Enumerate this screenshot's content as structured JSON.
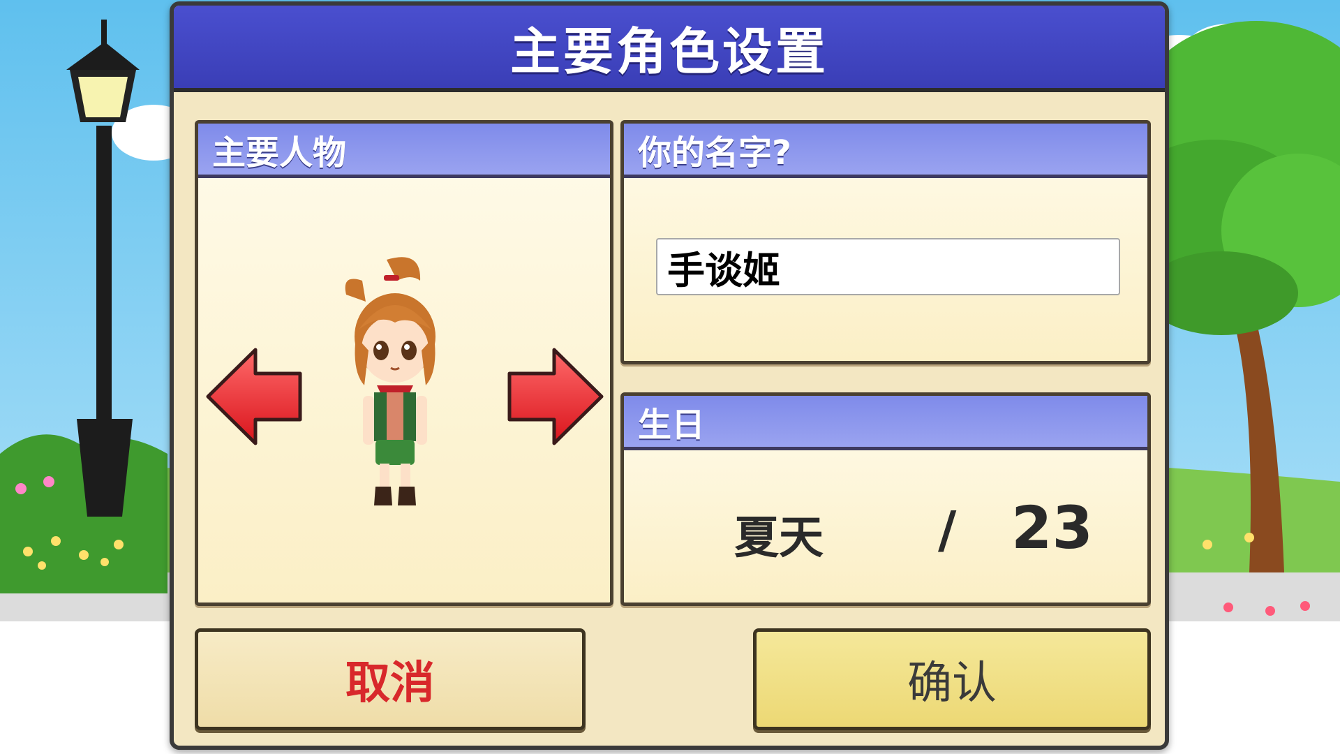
{
  "dialog": {
    "title": "主要角色设置"
  },
  "character_panel": {
    "header": "主要人物",
    "prev_arrow_icon": "left-arrow-icon",
    "next_arrow_icon": "right-arrow-icon",
    "arrow_color": "#e8222a"
  },
  "name_panel": {
    "header": "你的名字?",
    "name_value": "手谈姬"
  },
  "birthday_panel": {
    "header": "生日",
    "season": "夏天",
    "separator": "/",
    "day": "23"
  },
  "buttons": {
    "cancel_label": "取消",
    "confirm_label": "确认",
    "cancel_color": "#d8282b",
    "confirm_color": "#3a3a3a"
  },
  "colors": {
    "title_bar": "#4046c2",
    "panel_header": "#8590ec",
    "dialog_bg": "#f3e7c2"
  }
}
